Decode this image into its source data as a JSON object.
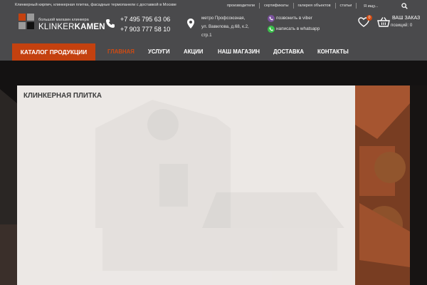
{
  "topbar": {
    "tagline": "Клинкерный кирпич, клинкерная плитка, фасадные термопанели с доставкой в Москве",
    "links": [
      "производители",
      "сертификаты",
      "галерея объектов",
      "статьи"
    ],
    "search_placeholder": "Я ищу..."
  },
  "logo": {
    "subtitle": "большой магазин клинкера",
    "name_light": "KLINKER",
    "name_bold": "KAMEN"
  },
  "contacts": {
    "phones": [
      "+7 495 795 63 06",
      "+7 903 777 58 10"
    ],
    "address_lines": [
      "метро Профсоюзная,",
      "ул. Вавилова, д.68, к.2,",
      "стр.1"
    ],
    "viber_label": "позвонить в viber",
    "whatsapp_label": "написать в whatsapp"
  },
  "cart": {
    "favorites_count": "0",
    "order_label": "ВАШ ЗАКАЗ",
    "order_items": "позиций: 0"
  },
  "nav": {
    "catalog_label": "КАТАЛОГ ПРОДУКЦИИ",
    "items": [
      {
        "label": "ГЛАВНАЯ",
        "active": true
      },
      {
        "label": "УСЛУГИ",
        "active": false
      },
      {
        "label": "АКЦИИ",
        "active": false
      },
      {
        "label": "НАШ МАГАЗИН",
        "active": false
      },
      {
        "label": "ДОСТАВКА",
        "active": false
      },
      {
        "label": "КОНТАКТЫ",
        "active": false
      }
    ]
  },
  "hero": {
    "title": "КЛИНКЕРНАЯ ПЛИТКА"
  },
  "colors": {
    "header_bg": "#4a4a4c",
    "accent": "#c4410f",
    "active_nav": "#d04a12",
    "viber": "#7b519d",
    "whatsapp": "#3bbf4b"
  },
  "icons": [
    "search-icon",
    "logo-mark-icon",
    "phone-icon",
    "map-pin-icon",
    "viber-icon",
    "whatsapp-icon",
    "heart-icon",
    "basket-icon"
  ]
}
